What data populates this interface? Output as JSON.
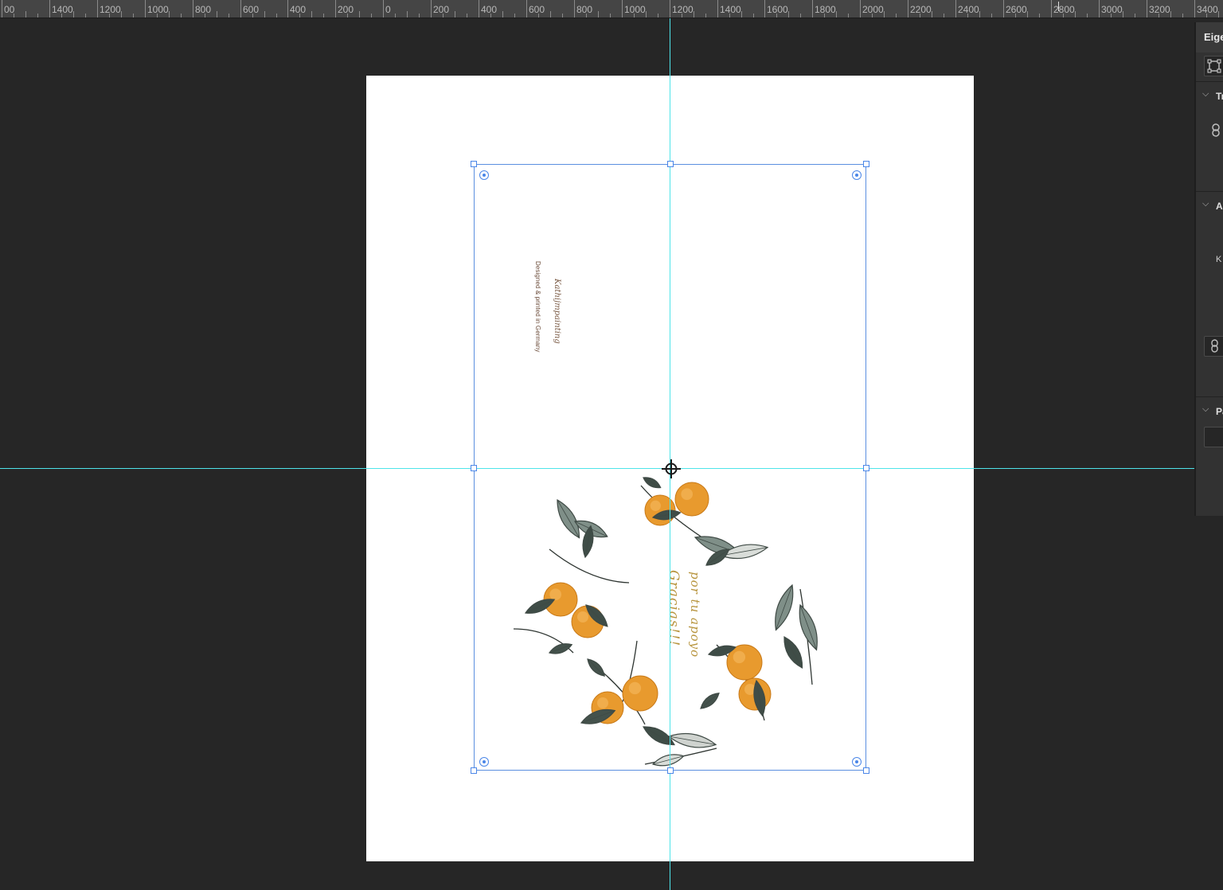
{
  "ruler": {
    "labels": [
      "00",
      "1400",
      "1200",
      "1000",
      "800",
      "600",
      "400",
      "200",
      "0",
      "200",
      "400",
      "600",
      "800",
      "1000",
      "1200",
      "1400",
      "1600",
      "1800",
      "2000",
      "2200",
      "2400",
      "2600",
      "2800",
      "3000",
      "3200",
      "3400"
    ]
  },
  "document": {
    "credit_signature": "Kathijmpainting",
    "credit_line": "Designed & printed in Germany",
    "greeting_line1": "Gracias!!!",
    "greeting_line2": "por tu apoyo"
  },
  "properties_panel": {
    "title": "Eige",
    "section1": "Tr",
    "section2": "A",
    "section2_text": "K",
    "section3": "Pa",
    "chevron": "⌵"
  },
  "colors": {
    "canvas_bg": "#262626",
    "guide": "#4ee4ea",
    "selection": "#5b8fe0",
    "orange": "#e89a2e",
    "leaf": "#7f8f88"
  }
}
